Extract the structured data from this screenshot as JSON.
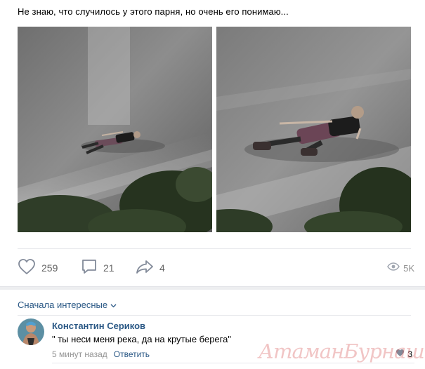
{
  "post": {
    "text": "Не знаю, что случилось у этого парня, но очень его понимаю..."
  },
  "actions": {
    "likes": "259",
    "comments": "21",
    "shares": "4",
    "views": "5K"
  },
  "comments": {
    "sort_label": "Сначала интересные",
    "items": [
      {
        "author": "Константин Сериков",
        "text": "\" ты неси меня река, да на крутые берега\"",
        "time": "5 минут назад",
        "reply_label": "Ответить",
        "likes": "3"
      }
    ]
  },
  "watermark": "АтаманБурнаш для ЯП",
  "icons": {
    "like": "heart-icon",
    "comment": "comment-bubble-icon",
    "share": "share-arrow-icon",
    "views": "eye-icon",
    "sort": "chevron-down-icon"
  },
  "colors": {
    "link": "#2a5885",
    "muted": "#939393",
    "counter": "#656565",
    "divider": "#e7e8ec",
    "watermark": "#d75a5a"
  }
}
